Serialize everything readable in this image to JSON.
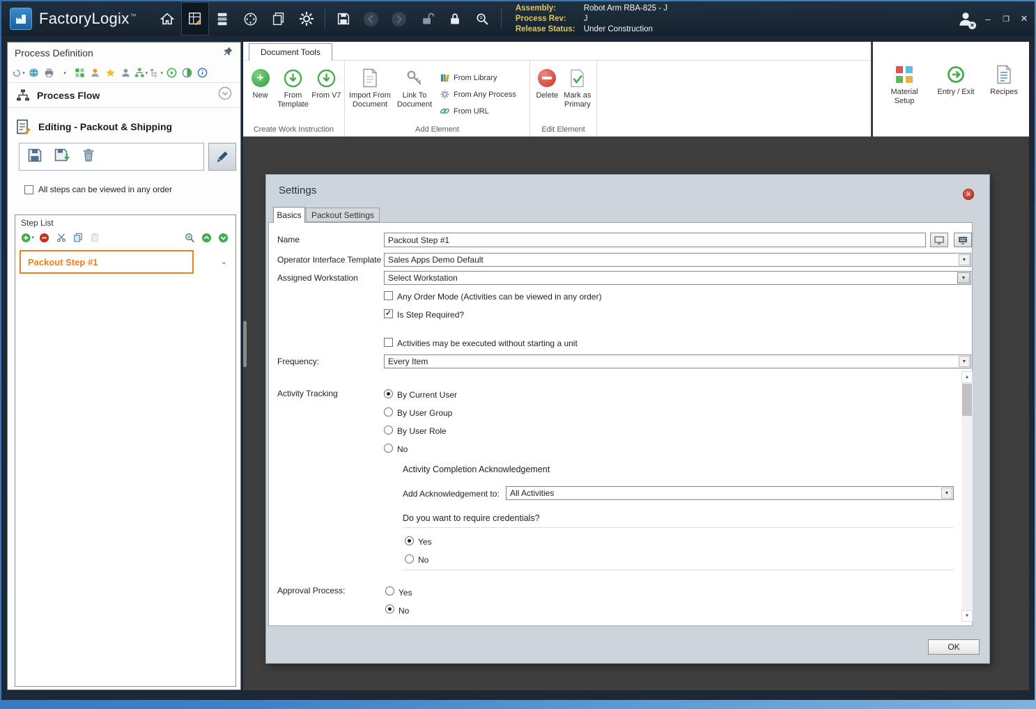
{
  "colors": {
    "titlebar_bg": "#18242f",
    "window_border_blue": "#3b82c9",
    "accent_orange": "#e8821e",
    "workspace_bg": "#3e3e3e",
    "dialog_bg": "#cdd5dc",
    "label_yellow": "#e3c75c",
    "ribbon_green": "#2f9e3f",
    "delete_red": "#c62f21"
  },
  "titlebar": {
    "app_name": "FactoryLogix",
    "trademark": "™",
    "assembly_label": "Assembly:",
    "assembly_value": "Robot Arm RBA-825 - J",
    "process_rev_label": "Process Rev:",
    "process_rev_value": "J",
    "release_status_label": "Release Status:",
    "release_status_value": "Under Construction"
  },
  "sidebar": {
    "title": "Process Definition",
    "process_flow": "Process Flow",
    "editing": "Editing - Packout & Shipping",
    "any_order": "All steps can be viewed in any order",
    "step_list": "Step List",
    "step1": "Packout Step #1"
  },
  "ribbon": {
    "tab": "Document Tools",
    "new": "New",
    "from_template": "From Template",
    "from_v7": "From V7",
    "group1": "Create Work Instruction",
    "import_from_document": "Import From Document",
    "link_to_document": "Link To Document",
    "from_library": "From Library",
    "from_any_process": "From Any Process",
    "from_url": "From URL",
    "group2": "Add Element",
    "delete": "Delete",
    "mark_as_primary": "Mark as Primary",
    "group3": "Edit Element",
    "material_setup": "Material Setup",
    "entry_exit": "Entry / Exit",
    "recipes": "Recipes"
  },
  "dialog": {
    "title": "Settings",
    "tab_basics": "Basics",
    "tab_packout": "Packout Settings",
    "name_label": "Name",
    "name_value": "Packout Step #1",
    "oit_label": "Operator Interface Template",
    "oit_value": "Sales Apps Demo Default",
    "workstation_label": "Assigned Workstation",
    "workstation_value": "Select Workstation",
    "any_order_mode": "Any Order Mode (Activities can be viewed in any order)",
    "is_step_required": "Is Step Required?",
    "activities_no_unit": "Activities may be executed without starting a unit",
    "frequency_label": "Frequency:",
    "frequency_value": "Every Item",
    "activity_tracking_label": "Activity Tracking",
    "track_current_user": "By Current User",
    "track_user_group": "By User Group",
    "track_user_role": "By User Role",
    "track_no": "No",
    "ack_header": "Activity Completion Acknowledgement",
    "ack_label": "Add Acknowledgement to:",
    "ack_value": "All Activities",
    "credentials_q": "Do you want to require credentials?",
    "cred_yes": "Yes",
    "cred_no": "No",
    "approval_label": "Approval Process:",
    "approval_yes": "Yes",
    "approval_no": "No",
    "ok": "OK"
  }
}
